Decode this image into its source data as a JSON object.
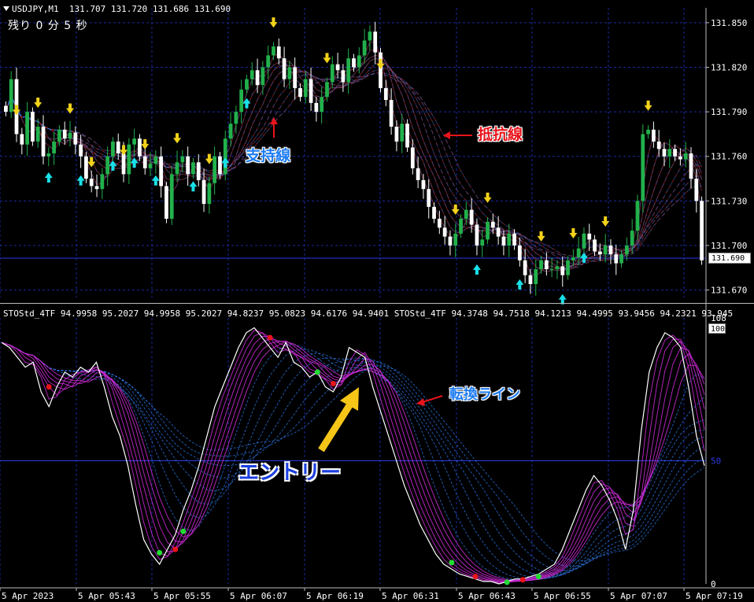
{
  "header": {
    "symbol": "USDJPY,M1",
    "ohlc": "131.707 131.720 131.686 131.690",
    "timer": "残り 0 分 5 秒"
  },
  "indicator_header": "STOStd_4TF 94.9958 95.2027 94.9958 95.2027 94.8237 95.0823 94.6176 94.9401   STOStd_4TF 94.3748 94.7518 94.1213 94.4995 93.9456 94.2321 93.945",
  "annotations": {
    "support": "支持線",
    "resistance": "抵抗線",
    "entry": "エントリー",
    "switch_line": "転換ライン"
  },
  "price_tag": "131.690",
  "stoch_tag": "100",
  "stoch_mid_label": "50",
  "colors": {
    "bull": "#22b14c",
    "bear": "#ffffff",
    "grid": "#1a2a9e",
    "arrow_up": "#19e0e8",
    "arrow_down": "#f2d21a",
    "ribbon_red": "#d8251f",
    "ribbon_blue": "#2d7df0",
    "osc": "#d02ad8"
  },
  "chart_data": [
    {
      "type": "candlestick",
      "symbol": "USDJPY,M1",
      "y_ticks": [
        "131.850",
        "131.820",
        "131.790",
        "131.760",
        "131.730",
        "131.700",
        "131.670"
      ],
      "ylim": [
        131.665,
        131.86
      ],
      "x_ticks": [
        "5 Apr 2023",
        "5 Apr 05:43",
        "5 Apr 05:55",
        "5 Apr 06:07",
        "5 Apr 06:19",
        "5 Apr 06:31",
        "5 Apr 06:43",
        "5 Apr 06:55",
        "5 Apr 07:07",
        "5 Apr 07:19"
      ],
      "close": [
        131.79,
        131.812,
        131.775,
        131.768,
        131.79,
        131.77,
        131.78,
        131.76,
        131.762,
        131.77,
        131.778,
        131.772,
        131.776,
        131.768,
        131.76,
        131.745,
        131.74,
        131.738,
        131.748,
        131.76,
        131.77,
        131.762,
        131.748,
        131.768,
        131.772,
        131.76,
        131.752,
        131.755,
        131.76,
        131.74,
        131.718,
        131.748,
        131.756,
        131.76,
        131.748,
        131.756,
        131.744,
        131.728,
        131.742,
        131.76,
        131.748,
        131.772,
        131.782,
        131.79,
        131.805,
        131.812,
        131.818,
        131.808,
        131.82,
        131.828,
        131.834,
        131.826,
        131.812,
        131.82,
        131.806,
        131.8,
        131.812,
        131.796,
        131.79,
        131.8,
        131.81,
        131.822,
        131.818,
        131.81,
        131.826,
        131.82,
        131.828,
        131.838,
        131.844,
        131.83,
        131.806,
        131.798,
        131.78,
        131.77,
        131.782,
        131.766,
        131.752,
        131.744,
        131.738,
        131.726,
        131.718,
        131.712,
        131.706,
        131.7,
        131.708,
        131.718,
        131.724,
        131.714,
        131.7,
        131.704,
        131.716,
        131.712,
        131.706,
        131.7,
        131.708,
        131.7,
        131.69,
        131.68,
        131.674,
        131.684,
        131.69,
        131.684,
        131.684,
        131.686,
        131.68,
        131.69,
        131.692,
        131.698,
        131.708,
        131.704,
        131.696,
        131.694,
        131.7,
        131.694,
        131.688,
        131.694,
        131.7,
        131.71,
        131.73,
        131.775,
        131.778,
        131.77,
        131.765,
        131.76,
        131.765,
        131.76,
        131.758,
        131.762,
        131.745,
        131.73,
        131.69
      ],
      "signals_up_idx": [
        8,
        14,
        20,
        24,
        28,
        35,
        41,
        45,
        88,
        96,
        104,
        108
      ],
      "signals_down_idx": [
        2,
        6,
        12,
        16,
        22,
        26,
        32,
        38,
        50,
        60,
        70,
        84,
        90,
        100,
        106,
        112,
        120
      ],
      "series": [
        {
          "name": "",
          "values": []
        }
      ]
    },
    {
      "type": "line",
      "indicator": "STOStd_4TF",
      "ylim": [
        0,
        108
      ],
      "y_ticks": [
        "108",
        "100",
        "50",
        "0"
      ],
      "x_ticks": [
        "5 Apr 2023",
        "5 Apr 05:43",
        "5 Apr 05:55",
        "5 Apr 06:07",
        "5 Apr 06:19",
        "5 Apr 06:31",
        "5 Apr 06:43",
        "5 Apr 06:55",
        "5 Apr 07:07",
        "5 Apr 07:19"
      ],
      "main": [
        98,
        96,
        92,
        88,
        90,
        78,
        72,
        80,
        86,
        84,
        88,
        86,
        90,
        80,
        68,
        60,
        48,
        32,
        18,
        12,
        8,
        14,
        20,
        30,
        38,
        48,
        60,
        72,
        80,
        88,
        96,
        102,
        104,
        100,
        96,
        92,
        98,
        90,
        88,
        84,
        86,
        80,
        78,
        84,
        96,
        94,
        92,
        80,
        70,
        60,
        50,
        40,
        32,
        24,
        18,
        12,
        8,
        6,
        4,
        3,
        2,
        1,
        1,
        0,
        1,
        2,
        2,
        3,
        4,
        6,
        8,
        14,
        22,
        30,
        38,
        44,
        40,
        34,
        26,
        14,
        30,
        62,
        86,
        96,
        102,
        100,
        96,
        80,
        60,
        48
      ]
    }
  ]
}
